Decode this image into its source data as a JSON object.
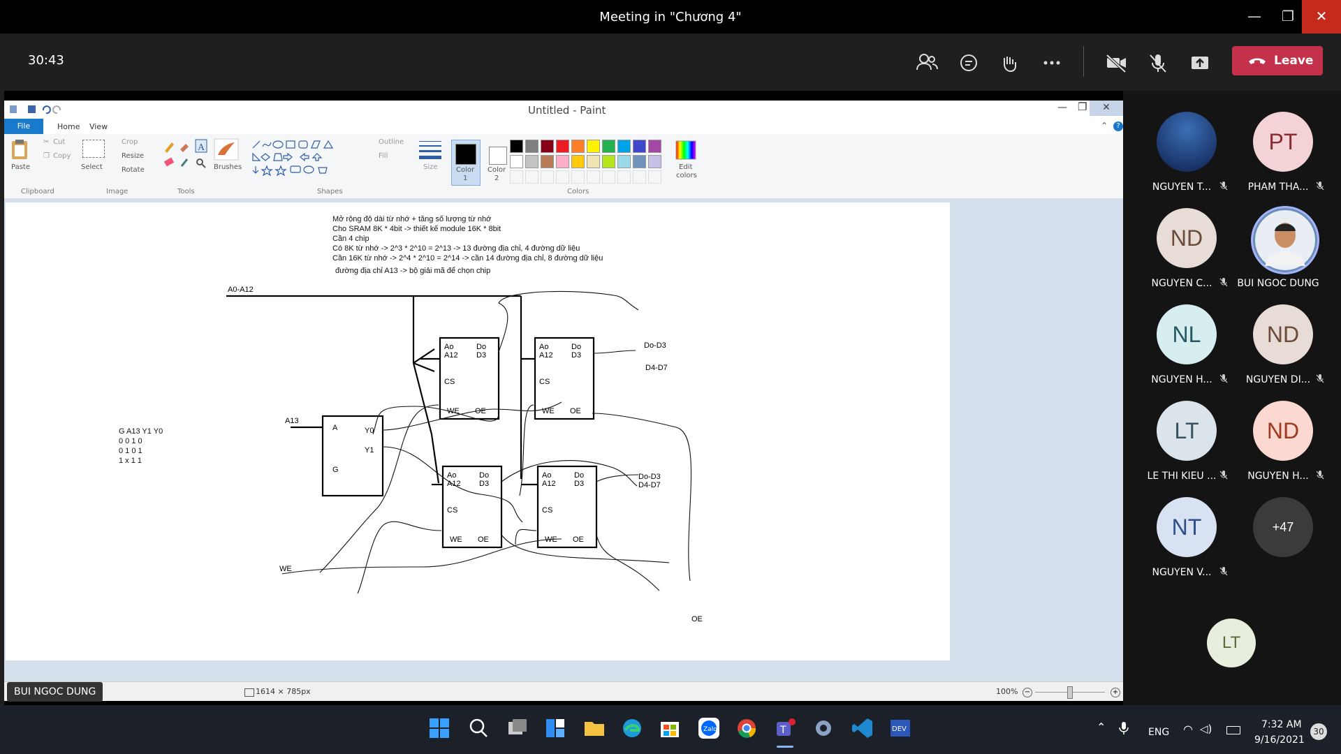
{
  "window": {
    "title": "Meeting in \"Chương 4\"",
    "minimize": "—",
    "maximize": "❐",
    "close": "✕"
  },
  "meeting": {
    "timer": "30:43",
    "leave_label": "Leave",
    "leave_color": "#c4314b"
  },
  "paint": {
    "title": "Untitled - Paint",
    "tabs": [
      "File",
      "Home",
      "View"
    ],
    "clipboard": {
      "paste": "Paste",
      "cut": "Cut",
      "copy": "Copy",
      "group": "Clipboard"
    },
    "image": {
      "select": "Select",
      "crop": "Crop",
      "resize": "Resize",
      "rotate": "Rotate",
      "group": "Image"
    },
    "tools": {
      "brushes": "Brushes",
      "group": "Tools"
    },
    "shapes": {
      "outline": "Outline",
      "fill": "Fill",
      "group": "Shapes"
    },
    "size": "Size",
    "color1": "Color\n1",
    "color1_a": "Color",
    "color1_b": "1",
    "color2_a": "Color",
    "color2_b": "2",
    "edit_colors_a": "Edit",
    "edit_colors_b": "colors",
    "colors_group": "Colors",
    "palette_row1": [
      "#000000",
      "#7f7f7f",
      "#880015",
      "#ed1c24",
      "#ff7f27",
      "#fff200",
      "#22b14c",
      "#00a2e8",
      "#3f48cc",
      "#a349a4"
    ],
    "palette_row2": [
      "#ffffff",
      "#c3c3c3",
      "#b97a57",
      "#ffaec9",
      "#ffc90e",
      "#efe4b0",
      "#b5e61d",
      "#99d9ea",
      "#7092be",
      "#c8bfe7"
    ],
    "status_size": "1614 × 785px",
    "zoom": "100%"
  },
  "notes": {
    "line1": "Mở rộng độ dài từ nhớ + tăng số lượng từ nhớ",
    "line2": "Cho SRAM 8K * 4bit -> thiết kế module 16K * 8bit",
    "line3": "Cần 4 chip",
    "line4": "Có 8K từ nhớ -> 2^3 * 2^10 = 2^13 -> 13 đường địa chỉ, 4 đường dữ liệu",
    "line5": "Cần 16K từ nhớ -> 2^4 * 2^10 = 2^14 -> cần 14 đường địa chỉ, 8 đường dữ liệu",
    "line6": "đường địa chỉ A13 -> bộ giải mã để chọn chip"
  },
  "diagram": {
    "bus_label": "A0-A12",
    "a13": "A13",
    "we": "WE",
    "oe": "OE",
    "decoder": {
      "a": "A",
      "g": "G",
      "y0": "Y0",
      "y1": "Y1"
    },
    "chip_ao": "Ao",
    "chip_a12": "A12",
    "chip_do": "Do",
    "chip_d3": "D3",
    "chip_cs": "CS",
    "chip_we": "WE",
    "chip_oe": "OE",
    "out1": "Do-D3",
    "out2": "D4-D7",
    "out3": "Do-D3",
    "out4": "D4-D7",
    "truth_header": "G  A13  Y1 Y0",
    "truth_row1": "0   0      1   0",
    "truth_row2": "0   1      0   1",
    "truth_row3": "1   x      1   1"
  },
  "presenter": "BUI NGOC DUNG",
  "participants": [
    {
      "initials": "",
      "name": "NGUYEN T...",
      "bg": "#1b3a7a",
      "fg": "#ffffff"
    },
    {
      "initials": "PT",
      "name": "PHAM THA...",
      "bg": "#f4d3d6",
      "fg": "#8a2a33"
    },
    {
      "initials": "ND",
      "name": "NGUYEN C...",
      "bg": "#e8dcd6",
      "fg": "#6b4a3a"
    },
    {
      "initials": "",
      "name": "BUI NGOC DUNG",
      "bg": "#6a8fb5",
      "fg": "#ffffff"
    },
    {
      "initials": "NL",
      "name": "NGUYEN H...",
      "bg": "#d6eef0",
      "fg": "#255a63"
    },
    {
      "initials": "ND",
      "name": "NGUYEN DI...",
      "bg": "#e8dcd6",
      "fg": "#6b4a3a"
    },
    {
      "initials": "LT",
      "name": "LE THI KIEU ...",
      "bg": "#dbe4ea",
      "fg": "#34525f"
    },
    {
      "initials": "ND",
      "name": "NGUYEN H...",
      "bg": "#fbd9d0",
      "fg": "#9c3b22"
    },
    {
      "initials": "NT",
      "name": "NGUYEN V...",
      "bg": "#d8e2f3",
      "fg": "#2e4f8a"
    },
    {
      "initials": "+47",
      "name": "",
      "bg": "#3b3b3b",
      "fg": "#ffffff"
    }
  ],
  "self_view": {
    "initials": "LT",
    "bg": "#e8eedd",
    "fg": "#5b6b3a"
  },
  "taskbar": {
    "lang": "ENG",
    "time": "7:32 AM",
    "date": "9/16/2021",
    "badge": "30"
  }
}
